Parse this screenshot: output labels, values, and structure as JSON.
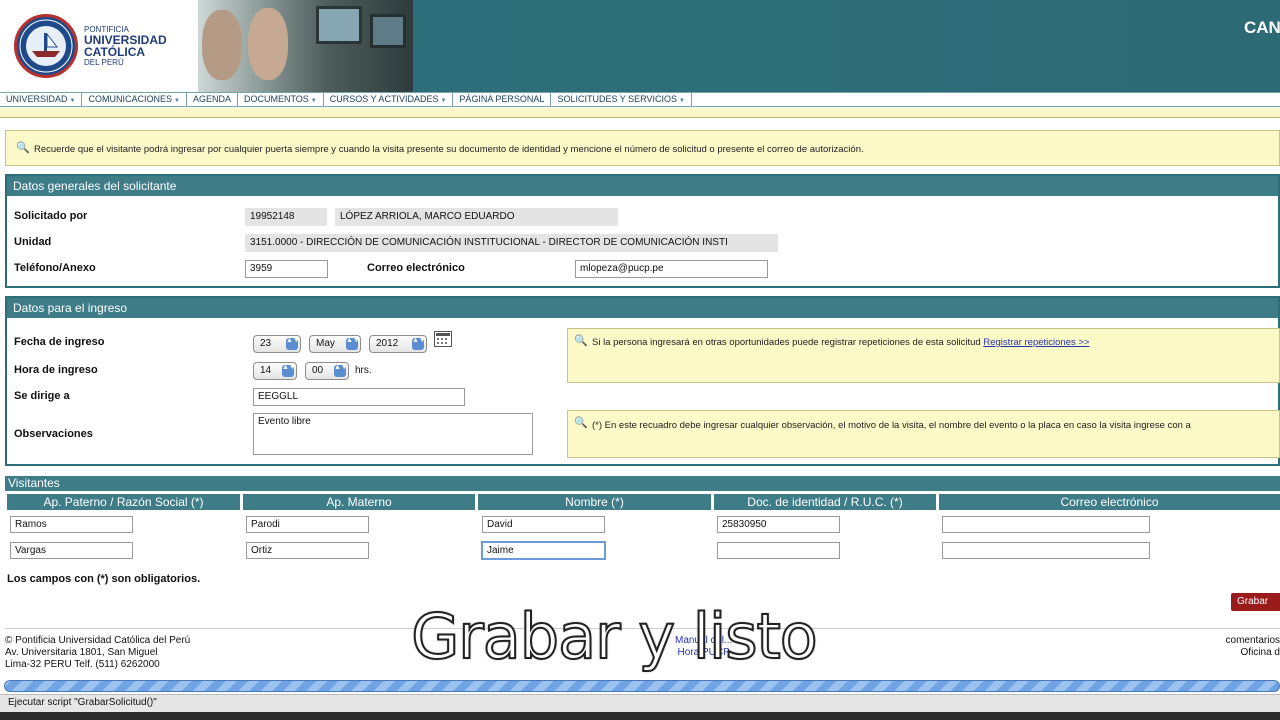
{
  "header": {
    "brand_line1": "PONTIFICIA",
    "brand_line2": "UNIVERSIDAD",
    "brand_line3": "CATÓLICA",
    "brand_line4": "DEL PERÚ",
    "seal_motto": "ET LUX IN TENEBRIS LUCET",
    "right_text": "CAN"
  },
  "nav": {
    "items": [
      {
        "label": "UNIVERSIDAD",
        "has_caret": true
      },
      {
        "label": "COMUNICACIONES",
        "has_caret": true
      },
      {
        "label": "AGENDA",
        "has_caret": false
      },
      {
        "label": "DOCUMENTOS",
        "has_caret": true
      },
      {
        "label": "CURSOS Y ACTIVIDADES",
        "has_caret": true
      },
      {
        "label": "PÁGINA PERSONAL",
        "has_caret": false
      },
      {
        "label": "SOLICITUDES Y SERVICIOS",
        "has_caret": true
      }
    ]
  },
  "notice": {
    "text": "Recuerde que el visitante podrá ingresar por cualquier puerta siempre y cuando la visita presente su documento de identidad y mencione el número de solicitud o presente el correo de autorización."
  },
  "general": {
    "title": "Datos generales del solicitante",
    "solicitado_label": "Solicitado por",
    "codigo": "19952148",
    "nombre": "LÓPEZ ARRIOLA, MARCO EDUARDO",
    "unidad_label": "Unidad",
    "unidad": "3151.0000 - DIRECCIÓN DE COMUNICACIÓN INSTITUCIONAL - DIRECTOR DE COMUNICACIÓN INSTI",
    "telefono_label": "Teléfono/Anexo",
    "telefono": "3959",
    "correo_label": "Correo electrónico",
    "correo": "mlopeza@pucp.pe"
  },
  "ingreso": {
    "title": "Datos para el ingreso",
    "fecha_label": "Fecha de ingreso",
    "dia": "23",
    "mes": "May",
    "anio": "2012",
    "hora_label": "Hora de ingreso",
    "hora": "14",
    "minuto": "00",
    "hrs_label": "hrs.",
    "dirige_label": "Se dirige a",
    "dirige": "EEGGLL",
    "obs_label": "Observaciones",
    "obs": "Evento libre",
    "info1_text": "Si la persona ingresará en otras oportunidades puede registrar repeticiones de esta solicitud",
    "info1_link": "Registrar repeticiones >>",
    "info2_text": "(*) En este recuadro debe ingresar cualquier observación, el motivo de la visita, el nombre del evento o la placa en caso la visita ingrese con a"
  },
  "visitantes": {
    "title": "Visitantes",
    "columns": [
      "Ap. Paterno / Razón Social (*)",
      "Ap. Materno",
      "Nombre (*)",
      "Doc. de identidad / R.U.C. (*)",
      "Correo electrónico"
    ],
    "rows": [
      [
        "Ramos",
        "Parodi",
        "David",
        "25830950",
        ""
      ],
      [
        "Vargas",
        "Ortiz",
        "Jaime",
        "",
        ""
      ]
    ],
    "required_note": "Los campos con (*) son obligatorios."
  },
  "actions": {
    "grabar": "Grabar"
  },
  "footer": {
    "line1": "© Pontificia Universidad Católica del Perú",
    "line2": "Av. Universitaria 1801, San Miguel",
    "line3": "Lima-32 PERU Telf. (511) 6262000",
    "mid1": "Manual del...",
    "mid2": "Hora PUCP",
    "right1": "comentarios",
    "right2": "Oficina d"
  },
  "caption": "Grabar y listo",
  "status_bar": "Ejecutar script \"GrabarSolicitud()\"",
  "colors": {
    "header_teal": "#2e6e79",
    "section_teal": "#3e7c88",
    "notice_yellow": "#fcf9c9",
    "button_red": "#9a1b1b",
    "link_blue": "#2432b0"
  }
}
